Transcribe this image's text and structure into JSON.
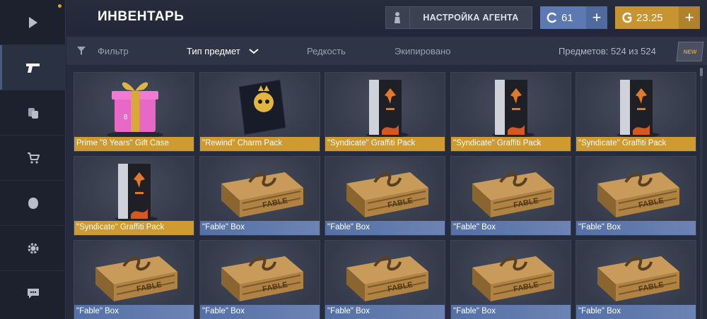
{
  "topbar": {
    "title": "ИНВЕНТАРЬ",
    "agent_button": "НАСТРОЙКА АГЕНТА",
    "blue_currency": "61",
    "gold_currency": "23.25",
    "plus": "+"
  },
  "sidebar": {
    "items": [
      {
        "icon": "play-icon"
      },
      {
        "icon": "pistol-icon"
      },
      {
        "icon": "coins-icon"
      },
      {
        "icon": "cart-icon"
      },
      {
        "icon": "helmet-icon"
      },
      {
        "icon": "gear-icon"
      },
      {
        "icon": "chat-icon"
      }
    ]
  },
  "filterbar": {
    "filter": "Фильтр",
    "type": "Тип предмет",
    "rarity": "Редкость",
    "equipped": "Экипировано",
    "count": "Предметов: 524 из 524",
    "new_badge": "NEW"
  },
  "colors": {
    "gold": "#cf9a2f",
    "blue": "#5d79b3"
  },
  "items": [
    {
      "name": "Prime \"8 Years\" Gift Case",
      "kind": "gift",
      "rarity": "gold"
    },
    {
      "name": "\"Rewind\" Charm Pack",
      "kind": "charm",
      "rarity": "gold"
    },
    {
      "name": "\"Syndicate\" Graffiti Pack",
      "kind": "graffiti",
      "rarity": "gold"
    },
    {
      "name": "\"Syndicate\" Graffiti Pack",
      "kind": "graffiti",
      "rarity": "gold"
    },
    {
      "name": "\"Syndicate\" Graffiti Pack",
      "kind": "graffiti",
      "rarity": "gold"
    },
    {
      "name": "\"Syndicate\" Graffiti Pack",
      "kind": "graffiti",
      "rarity": "gold"
    },
    {
      "name": "\"Fable\" Box",
      "kind": "box",
      "rarity": "blue"
    },
    {
      "name": "\"Fable\" Box",
      "kind": "box",
      "rarity": "blue"
    },
    {
      "name": "\"Fable\" Box",
      "kind": "box",
      "rarity": "blue"
    },
    {
      "name": "\"Fable\" Box",
      "kind": "box",
      "rarity": "blue"
    },
    {
      "name": "\"Fable\" Box",
      "kind": "box",
      "rarity": "blue"
    },
    {
      "name": "\"Fable\" Box",
      "kind": "box",
      "rarity": "blue"
    },
    {
      "name": "\"Fable\" Box",
      "kind": "box",
      "rarity": "blue"
    },
    {
      "name": "\"Fable\" Box",
      "kind": "box",
      "rarity": "blue"
    },
    {
      "name": "\"Fable\" Box",
      "kind": "box",
      "rarity": "blue"
    }
  ]
}
